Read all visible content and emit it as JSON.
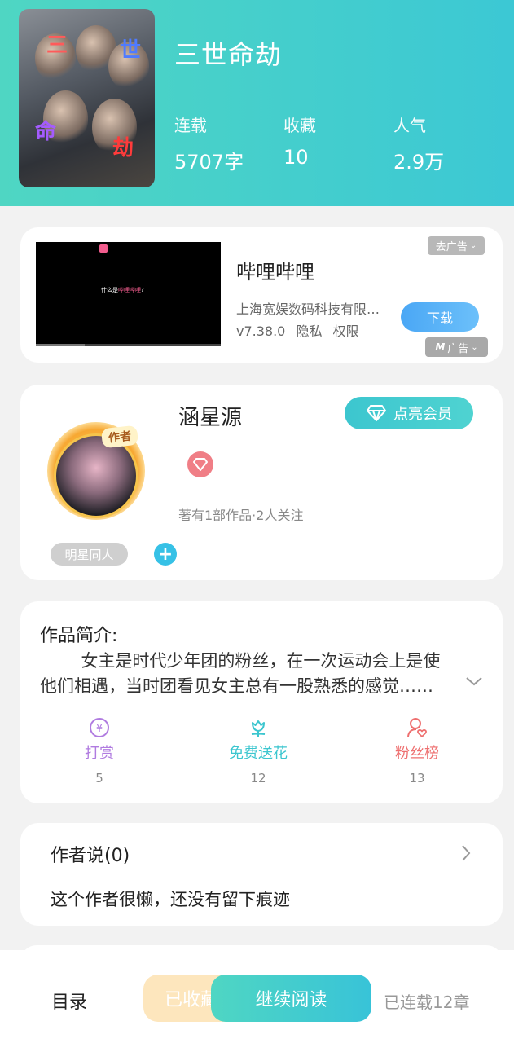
{
  "book": {
    "title": "三世命劫",
    "cover_glyphs": [
      "三",
      "世",
      "命",
      "劫"
    ],
    "stats": [
      {
        "label": "连载",
        "value": "5707字"
      },
      {
        "label": "收藏",
        "value": "10"
      },
      {
        "label": "人气",
        "value": "2.9万"
      }
    ]
  },
  "ad": {
    "video_caption_prefix": "什么是",
    "video_caption_highlight": "哔哩哔哩",
    "video_caption_suffix": "?",
    "app_name": "哔哩哔哩",
    "company": "上海宽娱数码科技有限公司",
    "version": "v7.38.0",
    "privacy": "隐私",
    "permissions": "权限",
    "download_label": "下载",
    "remove_ad_label": "去广告",
    "ad_tag_label": "广告"
  },
  "author": {
    "name": "涵星源",
    "badge_label": "作者",
    "vip_label": "点亮会员",
    "stats": "著有1部作品·2人关注",
    "genre_tag": "明星同人",
    "add_tag_label": "+"
  },
  "intro": {
    "title": "作品简介:",
    "text": "女主是时代少年团的粉丝，在一次运动会上是使他们相遇，当时团看见女主总有一股熟悉的感觉……",
    "actions": [
      {
        "label": "打赏",
        "count": "5",
        "color": "#b07be0",
        "icon": "yen-coin-icon"
      },
      {
        "label": "免费送花",
        "count": "12",
        "color": "#3cc6cf",
        "icon": "flower-icon"
      },
      {
        "label": "粉丝榜",
        "count": "13",
        "color": "#ee6f6f",
        "icon": "fan-person-icon"
      }
    ]
  },
  "author_says": {
    "title": "作者说(0)",
    "text": "这个作者很懒，还没有留下痕迹"
  },
  "bottom_bar": {
    "toc_label": "目录",
    "collected_label": "已收藏",
    "continue_label": "继续阅读",
    "chapters_label": "已连载12章"
  }
}
